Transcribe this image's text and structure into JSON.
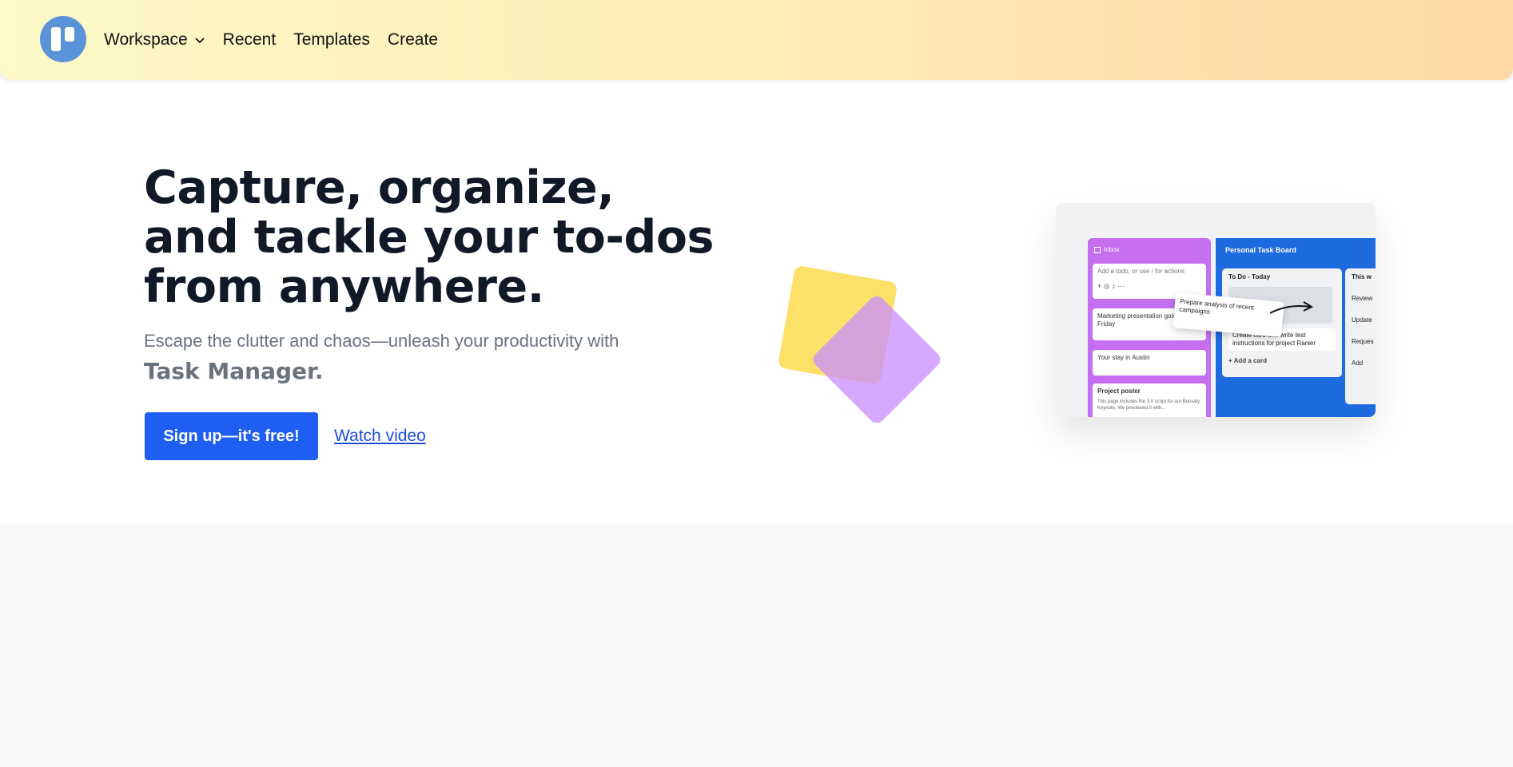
{
  "header": {
    "nav": [
      {
        "label": "Workspace",
        "has_dropdown": true
      },
      {
        "label": "Recent"
      },
      {
        "label": "Templates"
      },
      {
        "label": "Create"
      }
    ],
    "logo_color": "#5b93d8"
  },
  "hero": {
    "headline": "Capture, organize, and tackle your to-dos from anywhere.",
    "subtitle": "Escape the clutter and chaos—unleash your productivity with",
    "brand": "Task Manager.",
    "cta_label": "Sign up—it's free!",
    "watch_label": "Watch video",
    "accent_color": "#1e5ef3"
  },
  "preview": {
    "inbox_title": "Inbox",
    "inbox_input": "Add a todo, or use / for actions",
    "inbox_cards": [
      "Marketing presentation going up to Friday",
      "Your stay in Austin",
      "Project poster"
    ],
    "poster_desc": "This page includes the 3.0 script for our Bonsaly Keynote. We previewed it with...",
    "board_title": "Personal Task Board",
    "list_title": "To Do - Today",
    "list_card": "Create card and write test instructions for project Ranier",
    "add_card": "Add a card",
    "list2_title": "This w",
    "list2_items": [
      "Review",
      "Update",
      "Reques"
    ],
    "list2_add": "Add",
    "drag_card": "Prepare analysis of recent campaigns"
  }
}
